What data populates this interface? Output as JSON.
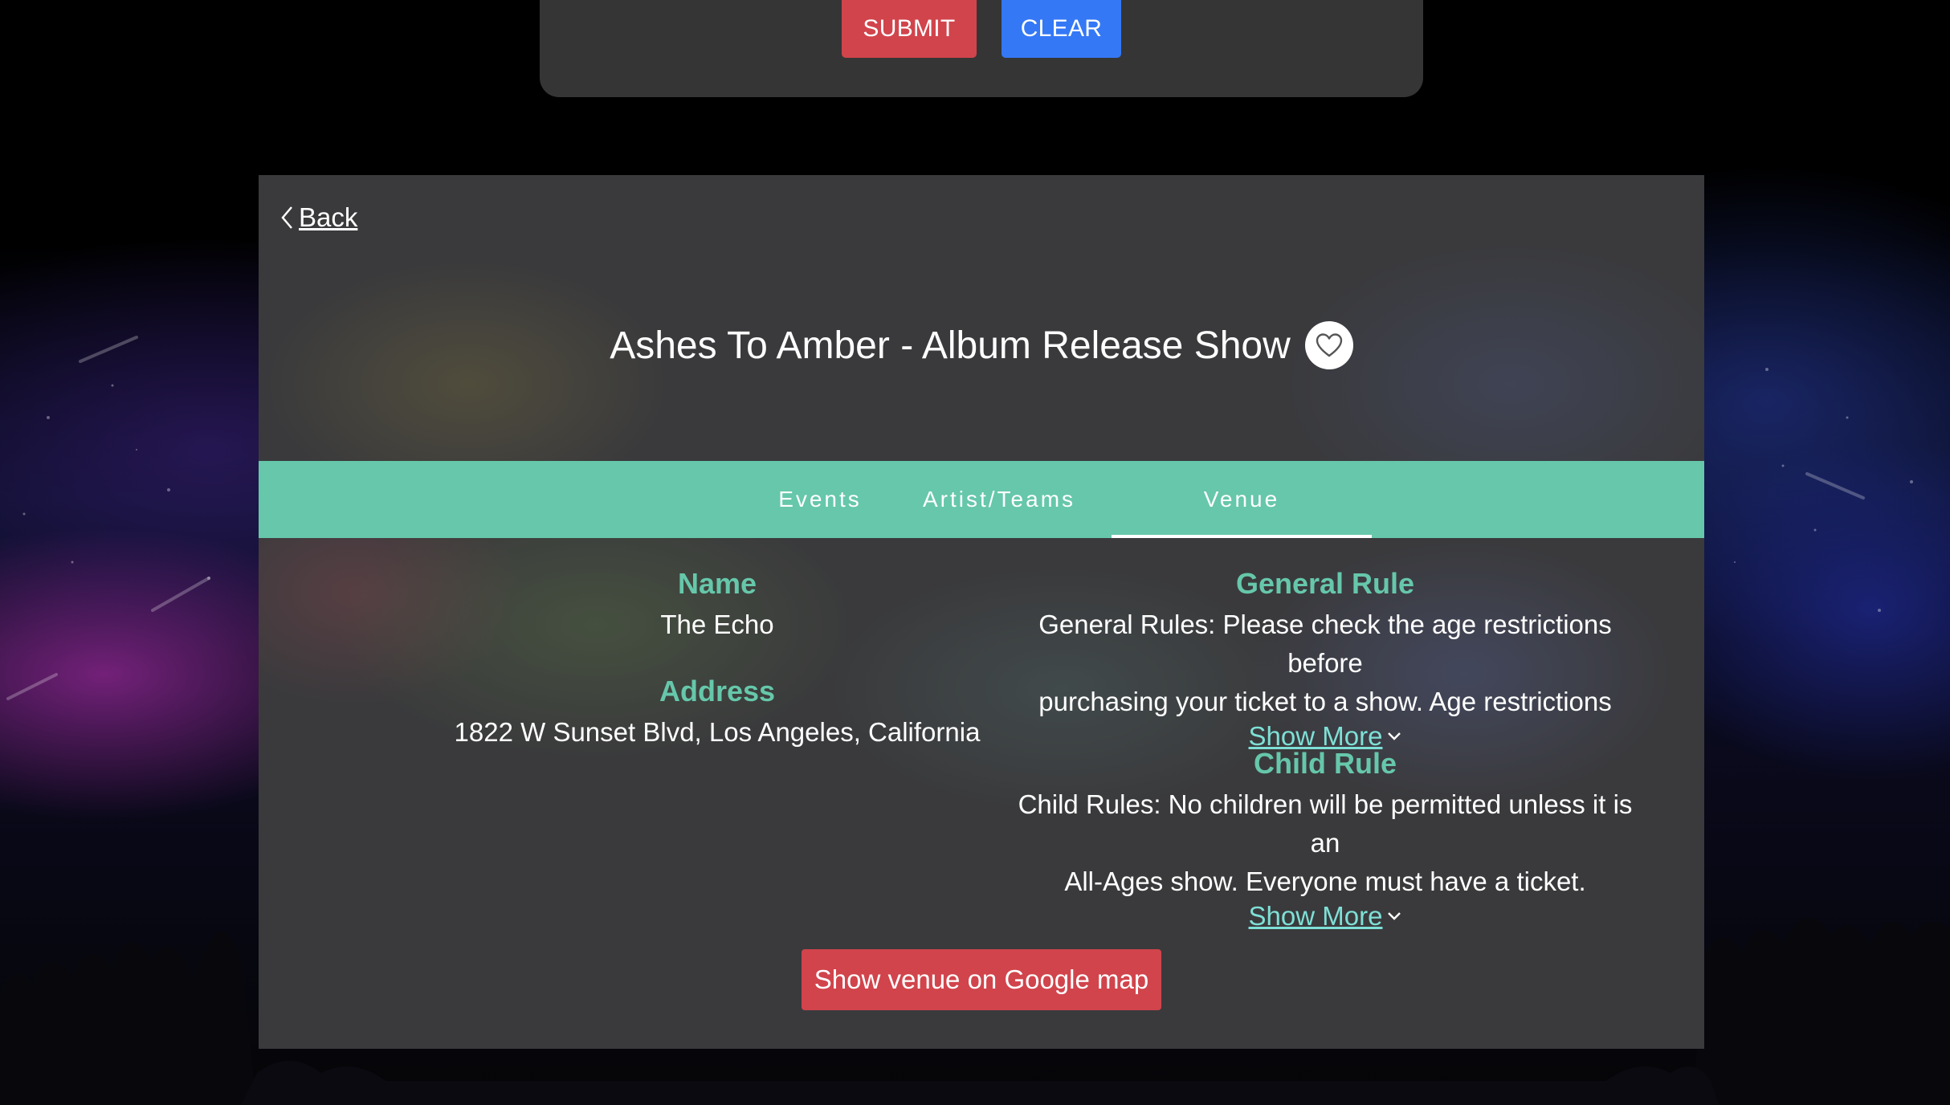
{
  "search_form": {
    "submit_label": "SUBMIT",
    "clear_label": "CLEAR"
  },
  "detail": {
    "back_label": "Back",
    "title": "Ashes To Amber - Album Release Show",
    "favorite_icon": "heart-outline-icon"
  },
  "tabs": [
    {
      "label": "Events",
      "active": false
    },
    {
      "label": "Artist/Teams",
      "active": false
    },
    {
      "label": "Venue",
      "active": true
    }
  ],
  "venue": {
    "name_heading": "Name",
    "name": "The Echo",
    "address_heading": "Address",
    "address": "1822 W Sunset Blvd, Los Angeles, California",
    "general_rule_heading": "General Rule",
    "general_rule_line1": "General Rules: Please check the age restrictions before",
    "general_rule_line2": "purchasing your ticket to a show. Age restrictions",
    "child_rule_heading": "Child Rule",
    "child_rule_line1": "Child Rules: No children will be permitted unless it is an",
    "child_rule_line2": "All-Ages show. Everyone must have a ticket.",
    "show_more_label": "Show More",
    "map_button_label": "Show venue on Google map"
  },
  "colors": {
    "accent_teal": "#66c7aa",
    "submit_red": "#d1444c",
    "clear_blue": "#3478f6",
    "link_cyan": "#7ee0d6",
    "card_bg": "#3a3a3c"
  }
}
